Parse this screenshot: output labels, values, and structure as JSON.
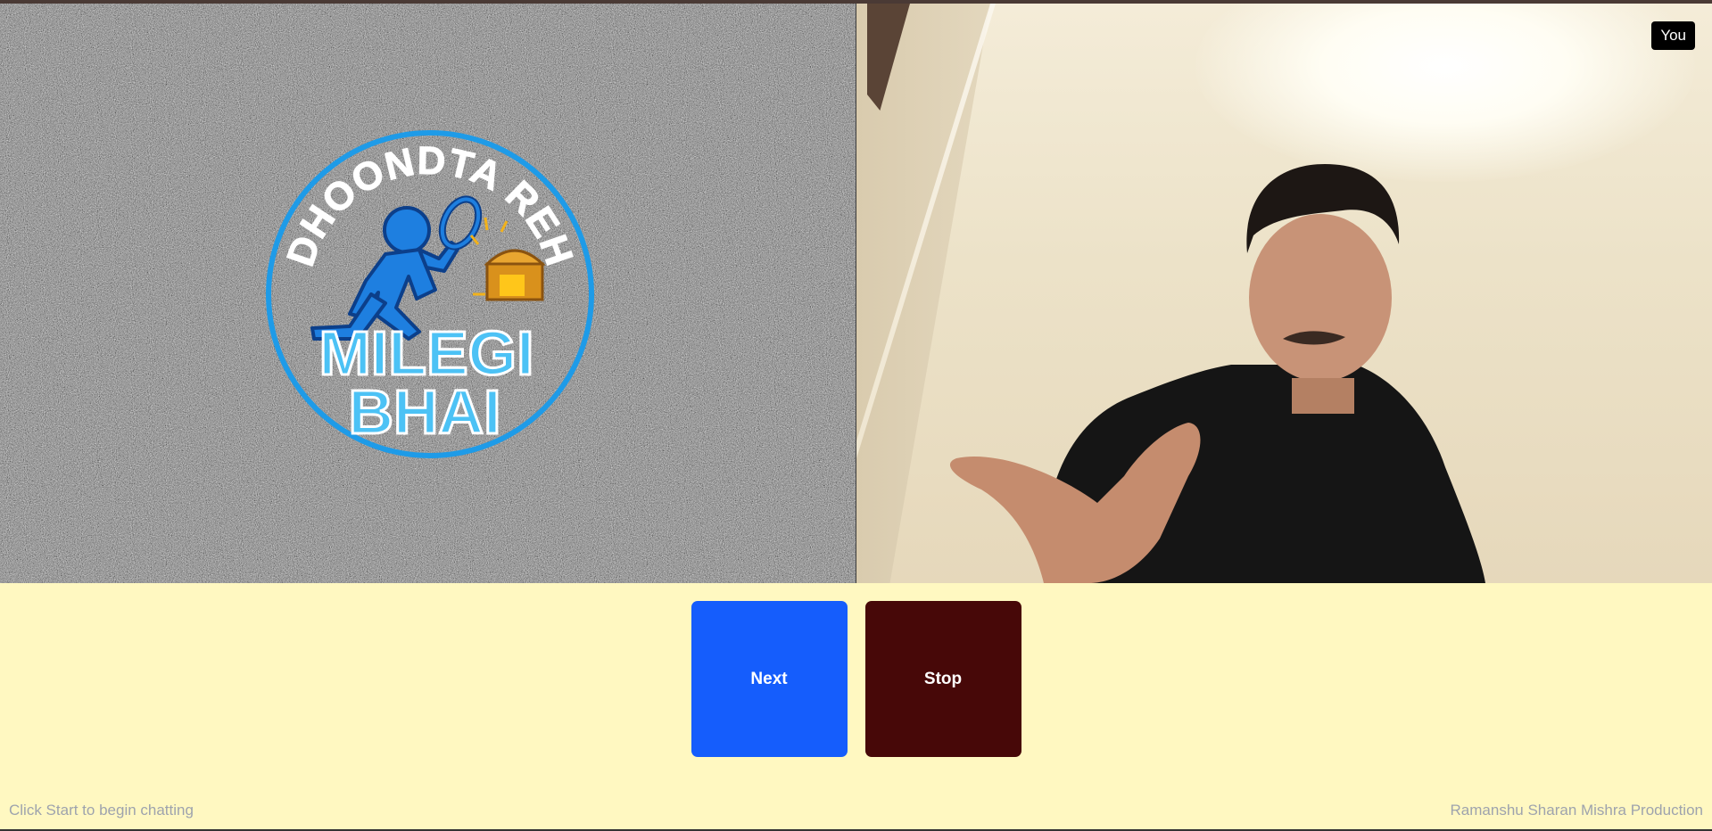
{
  "remote": {
    "logo": {
      "top_text": "DHOONDTA REH",
      "line1": "MILEGI",
      "line2": "BHAI",
      "icon": "searching-man-with-magnifier-and-treasure-chest"
    }
  },
  "local": {
    "badge": "You"
  },
  "controls": {
    "next_label": "Next",
    "stop_label": "Stop"
  },
  "footer": {
    "status": "Click Start to begin chatting",
    "credit": "Ramanshu Sharan Mishra Production"
  },
  "colors": {
    "page_background": "#fff8c1",
    "next_button": "#155dfc",
    "stop_button": "#470808",
    "logo_blue": "#1e9be8",
    "footer_text": "#9ea3ad"
  }
}
